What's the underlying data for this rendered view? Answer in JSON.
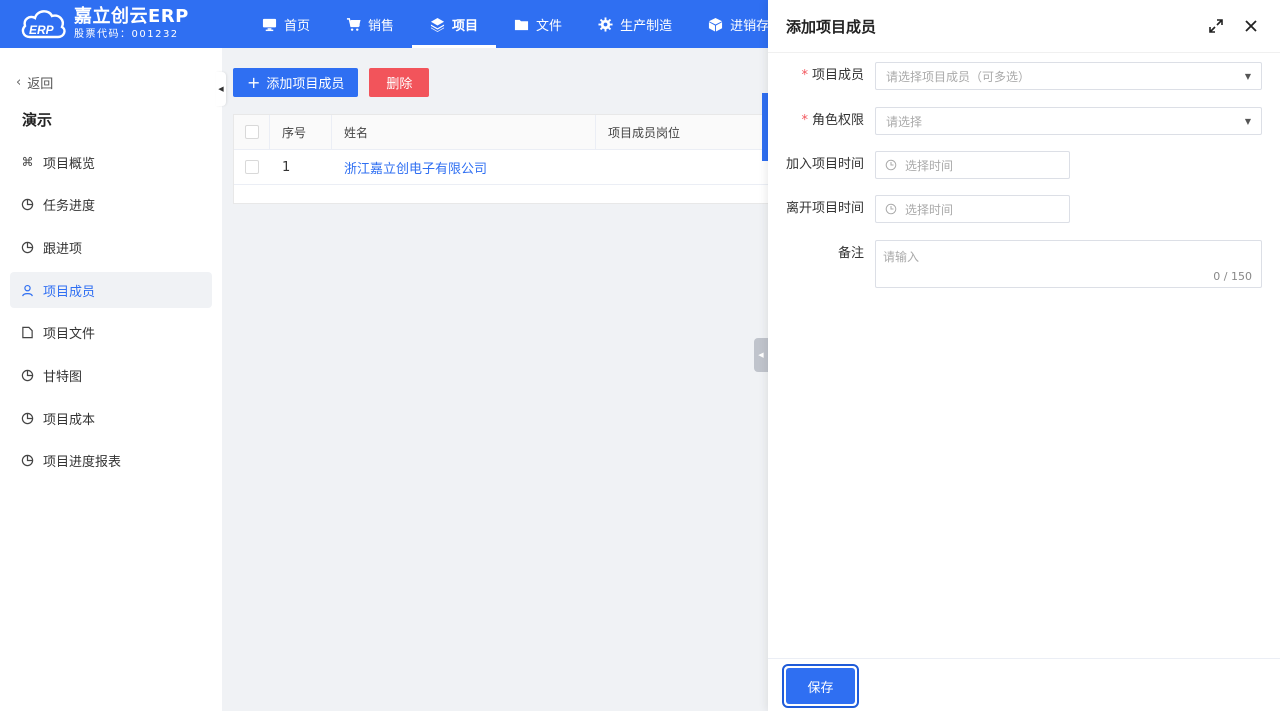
{
  "brand": {
    "title": "嘉立创云ERP",
    "subtitle": "股票代码：001232",
    "mark_text": "ERP"
  },
  "nav": [
    {
      "label": "首页",
      "icon": "monitor-icon"
    },
    {
      "label": "销售",
      "icon": "cart-icon"
    },
    {
      "label": "项目",
      "icon": "layers-icon",
      "active": true
    },
    {
      "label": "文件",
      "icon": "folder-icon"
    },
    {
      "label": "生产制造",
      "icon": "gear-icon"
    },
    {
      "label": "进销存",
      "icon": "box-icon"
    }
  ],
  "sidebar": {
    "back_label": "返回",
    "project_title": "演示",
    "items": [
      {
        "label": "项目概览",
        "icon": "command-icon"
      },
      {
        "label": "任务进度",
        "icon": "pie-icon"
      },
      {
        "label": "跟进项",
        "icon": "pie-icon"
      },
      {
        "label": "项目成员",
        "icon": "user-icon",
        "active": true
      },
      {
        "label": "项目文件",
        "icon": "file-icon"
      },
      {
        "label": "甘特图",
        "icon": "pie-icon"
      },
      {
        "label": "项目成本",
        "icon": "pie-icon"
      },
      {
        "label": "项目进度报表",
        "icon": "pie-icon"
      }
    ]
  },
  "toolbar": {
    "add_label": "添加项目成员",
    "delete_label": "删除"
  },
  "table": {
    "headers": {
      "no": "序号",
      "name": "姓名",
      "position": "项目成员岗位"
    },
    "rows": [
      {
        "no": "1",
        "name": "浙江嘉立创电子有限公司",
        "position": ""
      }
    ]
  },
  "drawer": {
    "title": "添加项目成员",
    "fields": {
      "members": {
        "label": "项目成员",
        "placeholder": "请选择项目成员（可多选）"
      },
      "role": {
        "label": "角色权限",
        "placeholder": "请选择"
      },
      "join_time": {
        "label": "加入项目时间",
        "placeholder": "选择时间"
      },
      "leave_time": {
        "label": "离开项目时间",
        "placeholder": "选择时间"
      },
      "remark": {
        "label": "备注",
        "placeholder": "请输入",
        "count": "0 / 150"
      }
    },
    "save_label": "保存"
  },
  "colors": {
    "primary": "#2f6ff2",
    "danger": "#f2545b"
  }
}
